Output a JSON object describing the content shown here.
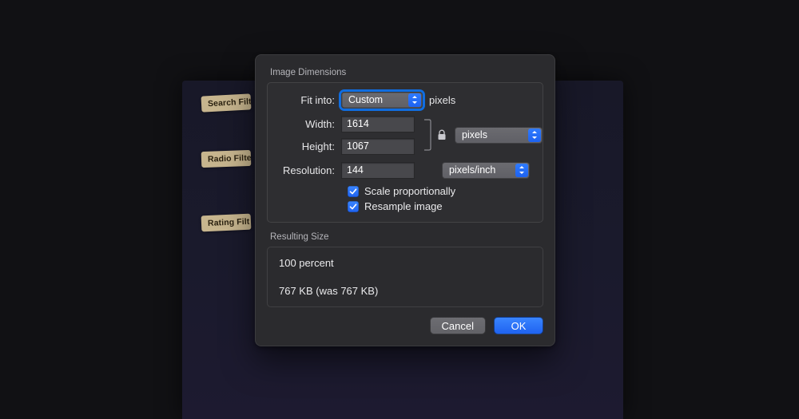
{
  "background_chips": {
    "chip1": "Search Filt",
    "chip2": "Radio Filte",
    "chip3": "Rating Filt"
  },
  "dialog": {
    "section_dimensions_label": "Image Dimensions",
    "fit_into_label": "Fit into:",
    "fit_into_value": "Custom",
    "fit_into_suffix": "pixels",
    "width_label": "Width:",
    "width_value": "1614",
    "height_label": "Height:",
    "height_value": "1067",
    "wh_unit_value": "pixels",
    "resolution_label": "Resolution:",
    "resolution_value": "144",
    "resolution_unit_value": "pixels/inch",
    "scale_checkbox_label": "Scale proportionally",
    "resample_checkbox_label": "Resample image",
    "resulting_label": "Resulting Size",
    "resulting_percent": "100 percent",
    "resulting_bytes": "767 KB (was 767 KB)",
    "cancel_label": "Cancel",
    "ok_label": "OK"
  }
}
